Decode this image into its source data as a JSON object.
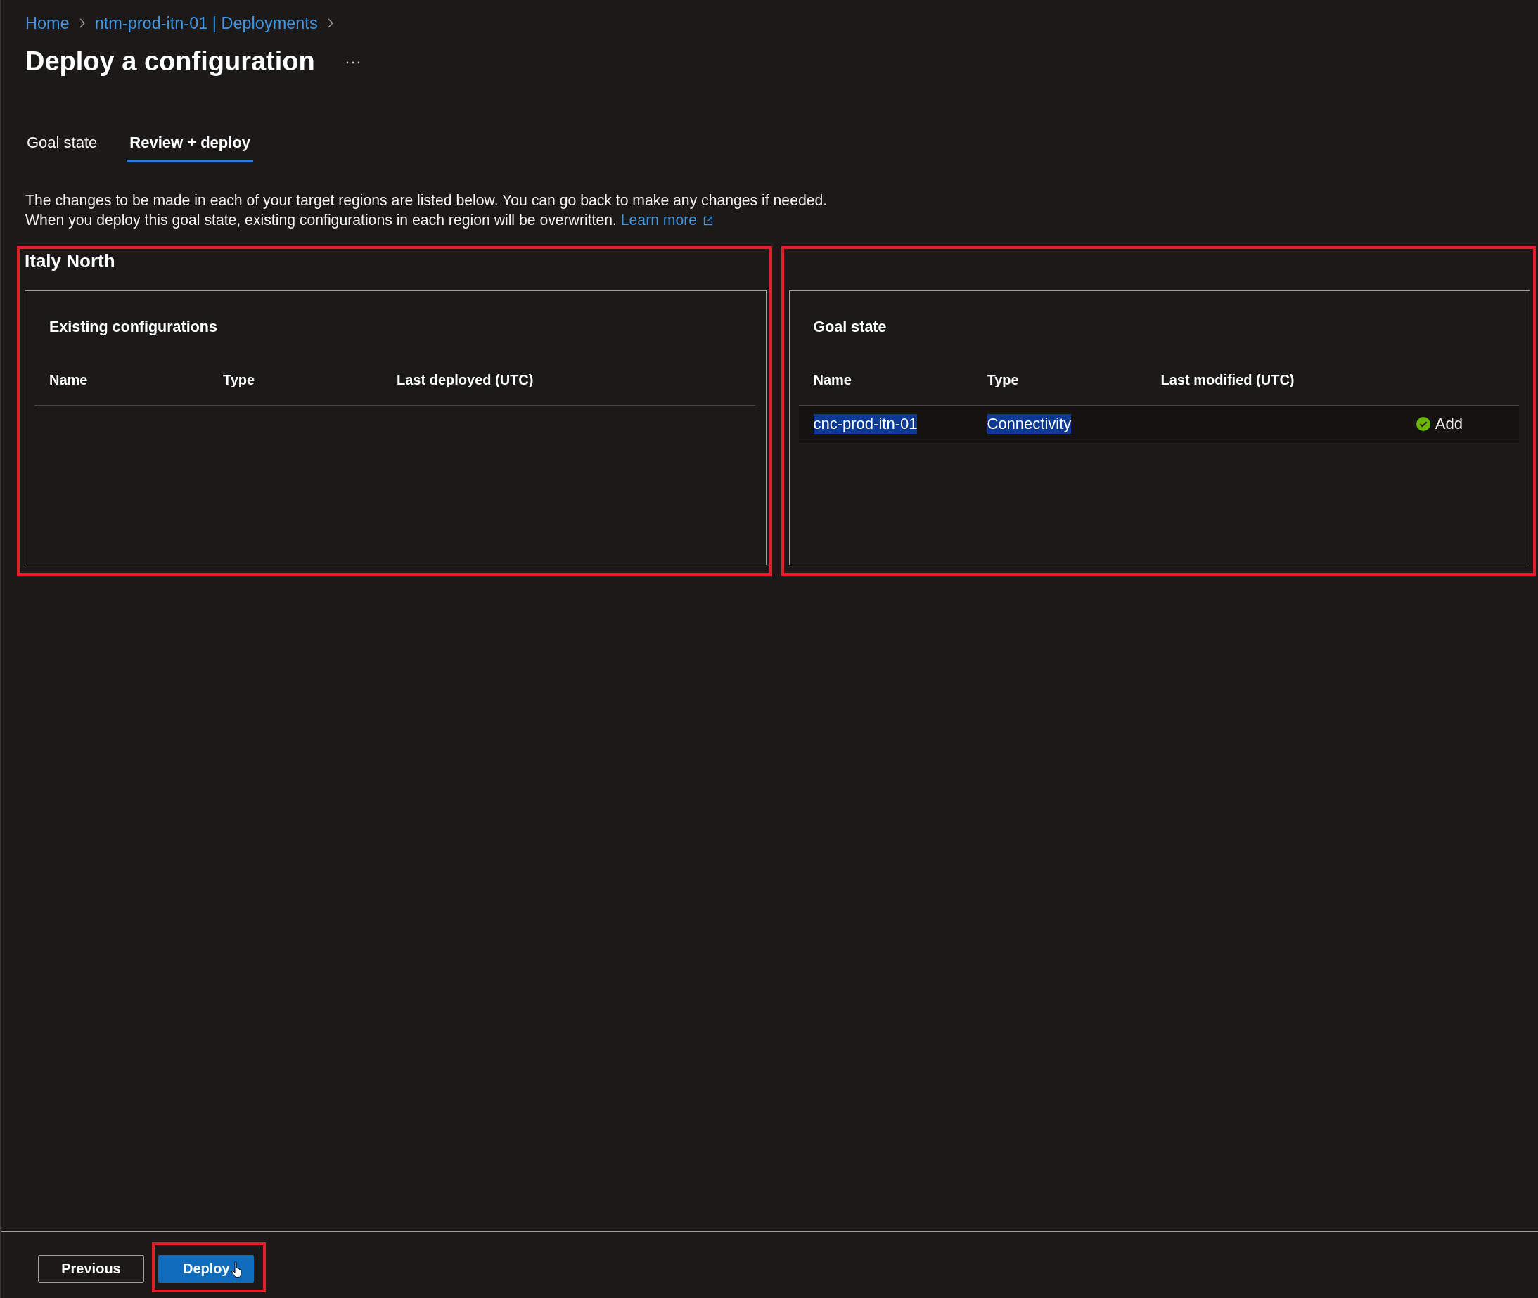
{
  "breadcrumb": [
    {
      "label": "Home"
    },
    {
      "label": "ntm-prod-itn-01 | Deployments"
    }
  ],
  "page": {
    "title": "Deploy a configuration"
  },
  "tabs": [
    {
      "label": "Goal state",
      "selected": false
    },
    {
      "label": "Review + deploy",
      "selected": true
    }
  ],
  "description": {
    "lines": [
      "The changes to be made in each of your target regions are listed below. You can go back to make any changes if needed.",
      "When you deploy this goal state, existing configurations in each region will be overwritten."
    ],
    "link": "Learn more"
  },
  "region": {
    "name": "Italy North",
    "panels": [
      {
        "annotated": true,
        "title": "Existing configurations",
        "columns": [
          "Name",
          "Type",
          "Last deployed (UTC)"
        ]
      },
      {
        "annotated": true,
        "title": "Goal state",
        "columns": [
          "Name",
          "Type",
          "Last modified (UTC)"
        ],
        "rows": [
          {
            "name": {
              "text": "cnc-prod-itn-01",
              "text_selected": true
            },
            "type": {
              "text": "Connectivity",
              "text_selected": true
            },
            "change": {
              "text": "Add",
              "kind": "add"
            }
          }
        ]
      }
    ]
  },
  "footer": {
    "buttons": [
      {
        "label": "Previous",
        "kind": "secondary",
        "annotated": false,
        "hovered": false
      },
      {
        "label": "Deploy",
        "kind": "primary",
        "annotated": true,
        "hovered": true
      }
    ]
  }
}
